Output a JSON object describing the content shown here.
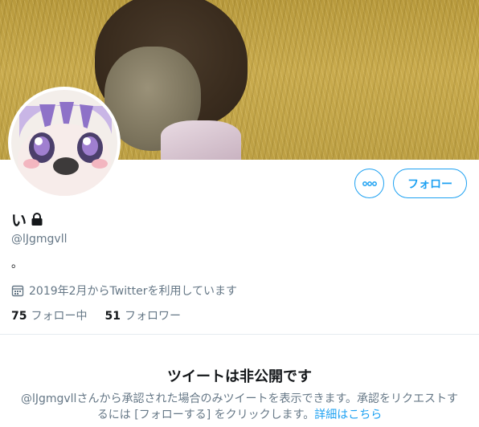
{
  "profile": {
    "display_name": "い",
    "handle": "@lJgmgvll",
    "bio": "。",
    "joined": "2019年2月からTwitterを利用しています"
  },
  "actions": {
    "more_icon": "more-dots-icon",
    "follow_label": "フォロー"
  },
  "stats": {
    "following_count": "75",
    "following_label": "フォロー中",
    "followers_count": "51",
    "followers_label": "フォロワー"
  },
  "protected_notice": {
    "title": "ツイートは非公開です",
    "body": "@lJgmgvllさんから承認された場合のみツイートを表示できます。承認をリクエストするには [フォローする] をクリックします。",
    "link": "詳細はこちら"
  },
  "colors": {
    "accent": "#1da1f2",
    "secondary_text": "#657786",
    "primary_text": "#14171a",
    "divider": "#e6ecf0"
  }
}
